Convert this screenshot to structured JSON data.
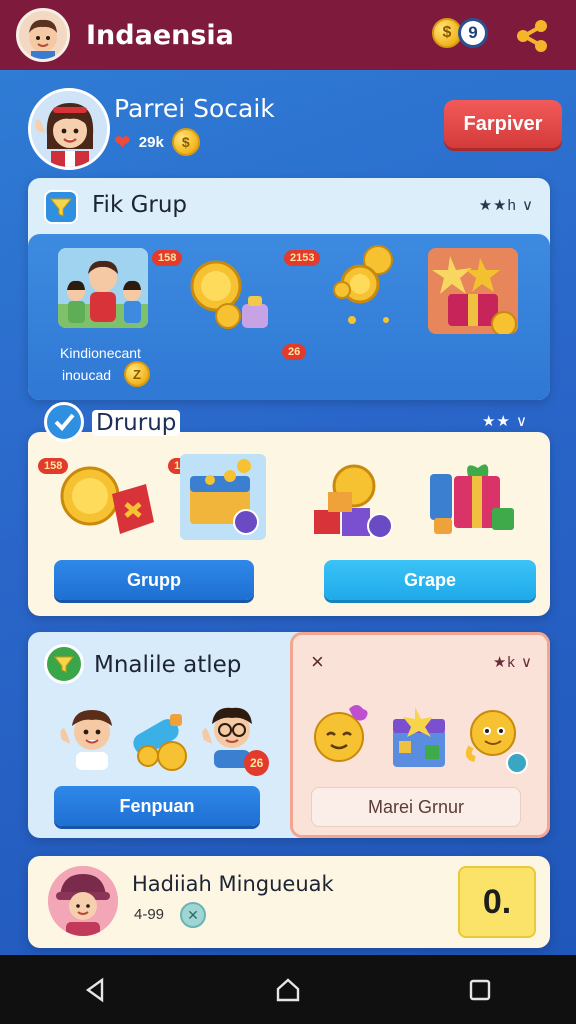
{
  "header": {
    "title": "Indaensia",
    "coin_icon": "gold-coin-icon",
    "coin_label": "9",
    "share_icon": "share-icon"
  },
  "profile": {
    "name": "Parrei Socaik",
    "stat_value": "29k",
    "follow_label": "Farpiver"
  },
  "group_card": {
    "title": "Fik Grup",
    "rating": "★★h ∨",
    "member_names": [
      "Kindionecant",
      "inoucad"
    ],
    "coin_badge": "Z",
    "badges": [
      "158",
      "2153",
      "26"
    ]
  },
  "drop_card": {
    "title": "Drurup",
    "rating": "★★ ∨",
    "badges": [
      "158",
      "156"
    ],
    "button_left": "Grupp",
    "button_right": "Grape"
  },
  "mobile_card": {
    "title": "Mnalile atlep",
    "badge": "26",
    "button_left": "Fenpuan",
    "right_close": "×",
    "right_rating": "★k ∨",
    "button_right": "Marei Grnur"
  },
  "reward_card": {
    "title": "Hadiiah Mingueuak",
    "stat": "4-99",
    "action_label": "0."
  },
  "colors": {
    "topbar": "#7e1a3c",
    "accent_red": "#e5484d",
    "accent_blue": "#1f6fd3",
    "background": "#2a66c9"
  }
}
